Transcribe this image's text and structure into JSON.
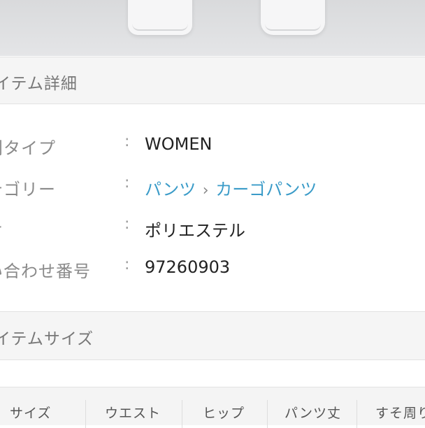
{
  "detail_section": {
    "header": "イテム詳細",
    "rows": [
      {
        "key": "別タイプ",
        "value": "WOMEN"
      },
      {
        "key": "テゴリー",
        "category": "パンツ",
        "subcategory": "カーゴパンツ"
      },
      {
        "key": "オ",
        "value": "ポリエステル"
      },
      {
        "key": "い合わせ番号",
        "value": "97260903"
      }
    ]
  },
  "size_section": {
    "header": "イテムサイズ",
    "columns": [
      "サイズ",
      "ウエスト",
      "ヒップ",
      "パンツ丈",
      "すそ周り"
    ]
  },
  "colors": {
    "link": "#3a9bc8",
    "section_bg": "#f5f5f5"
  }
}
